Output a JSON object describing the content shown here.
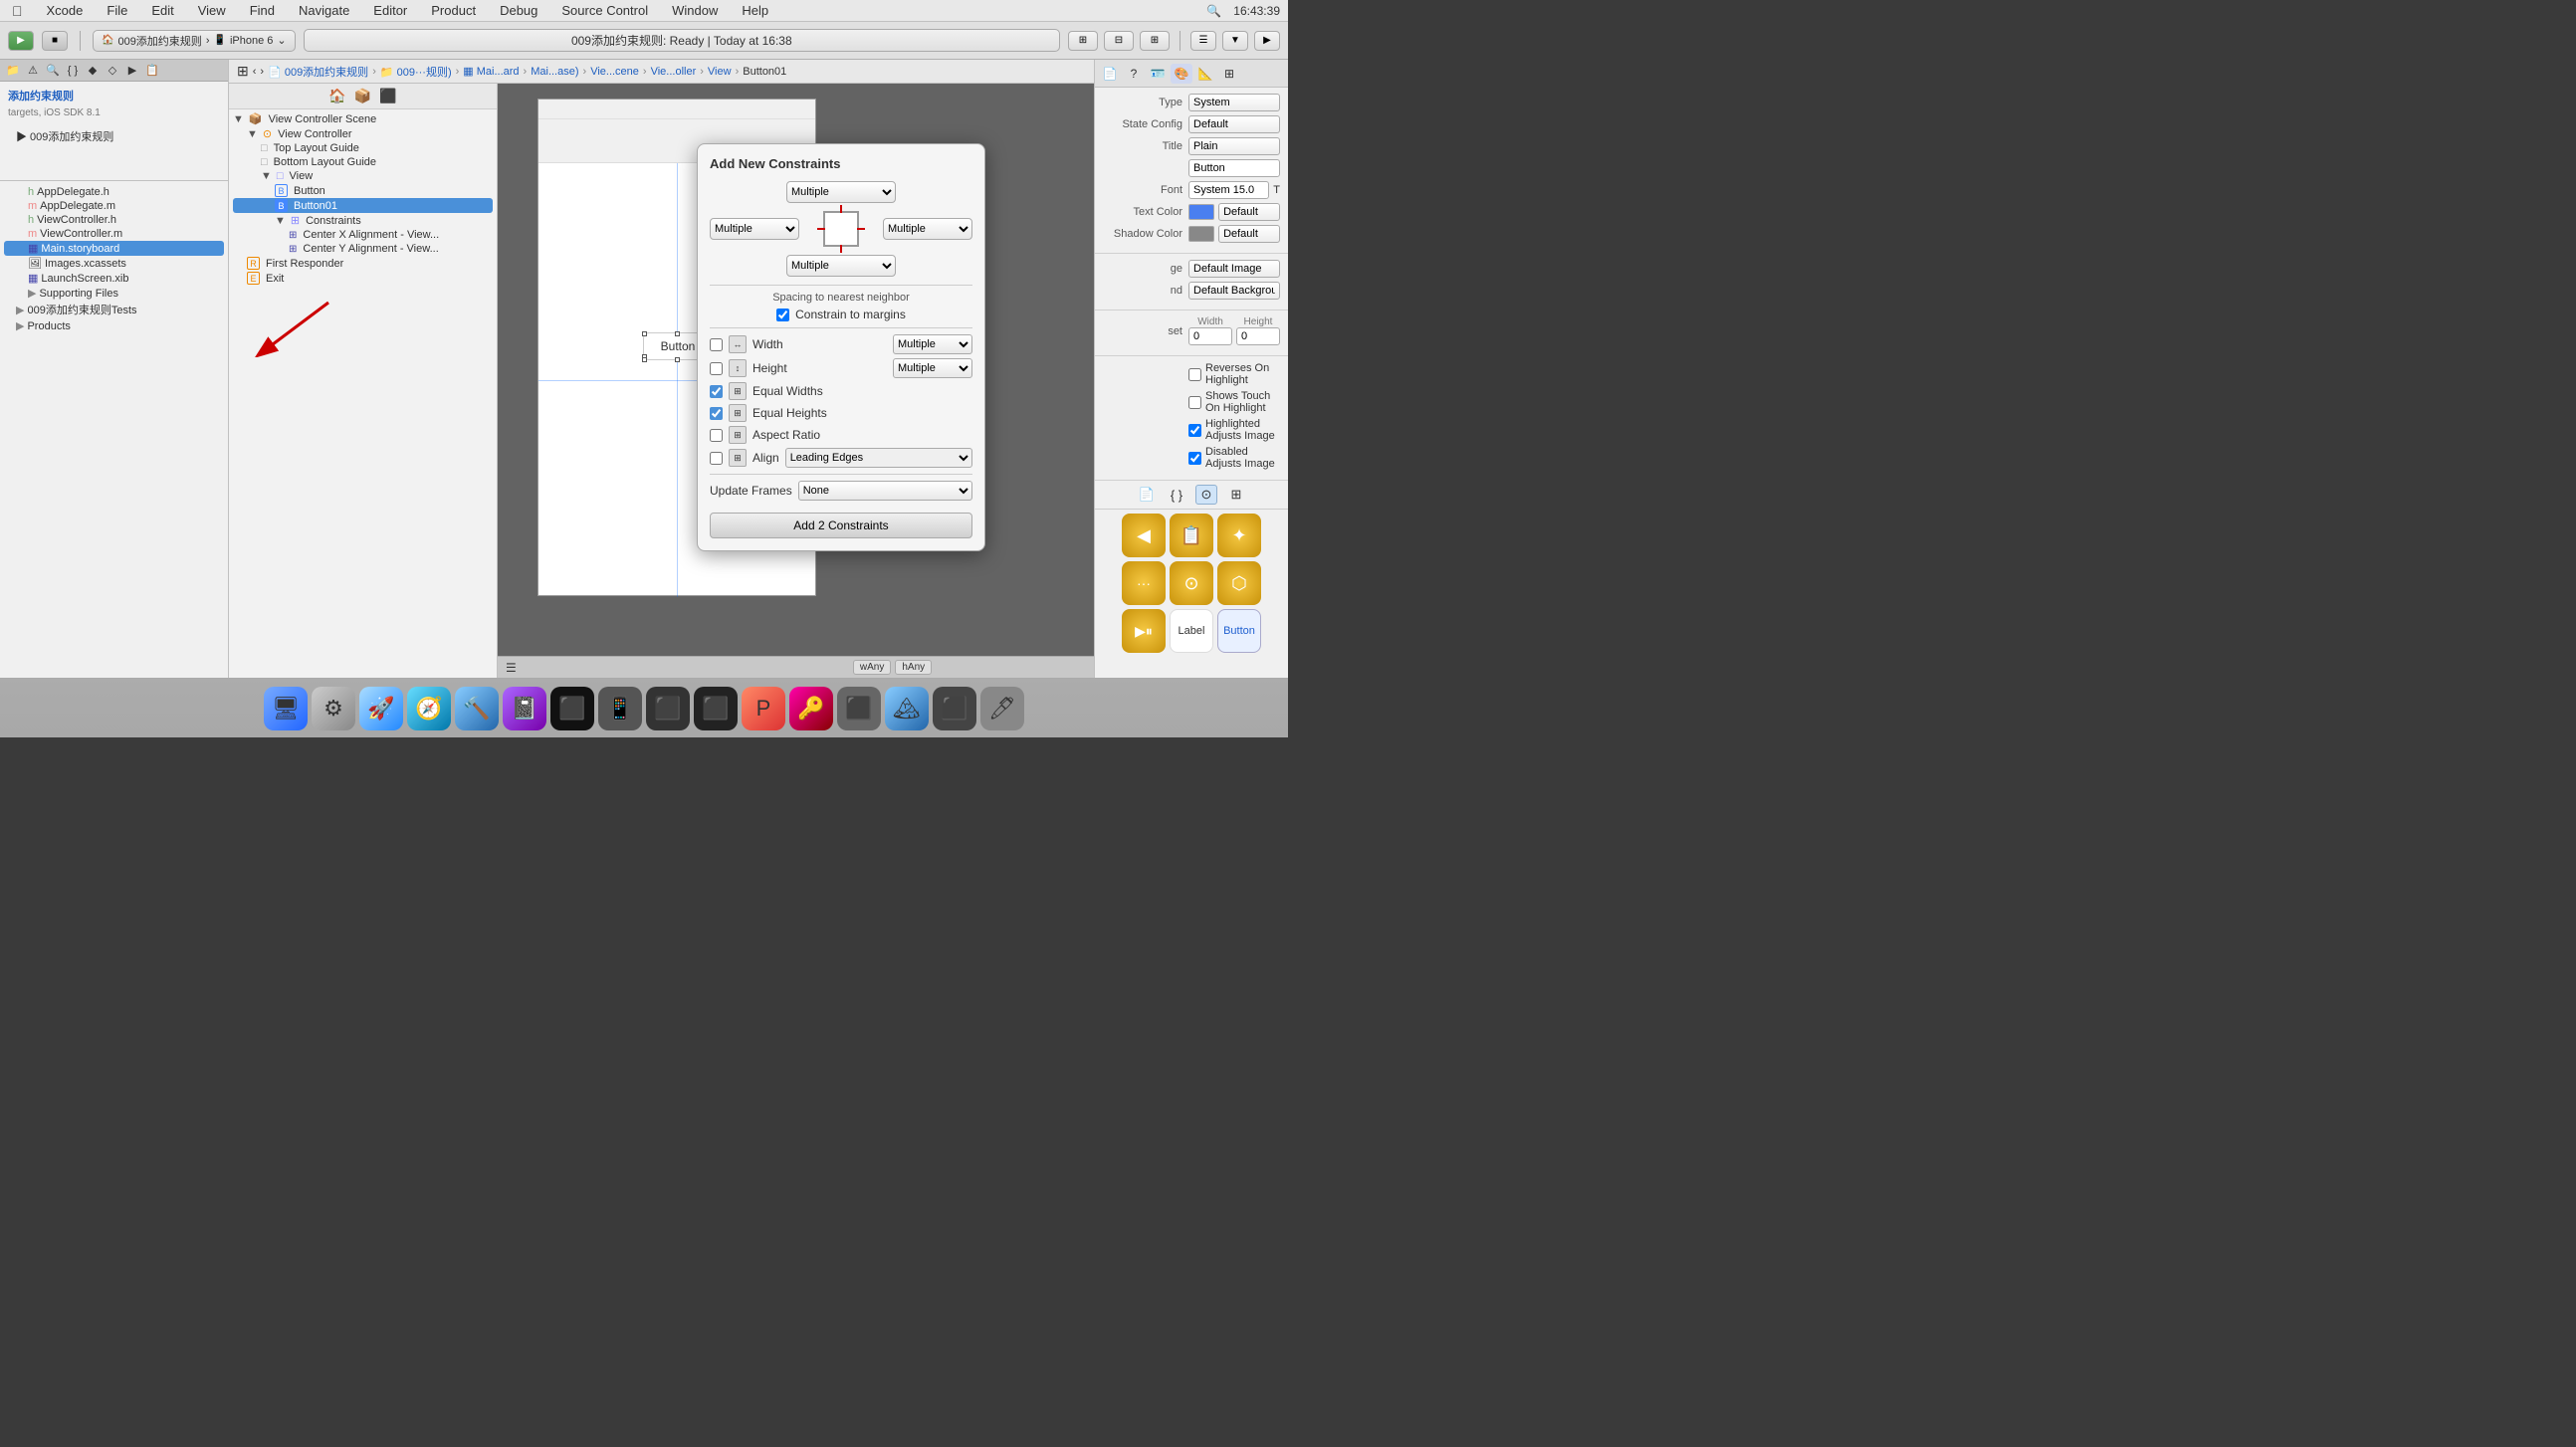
{
  "menubar": {
    "apple": "",
    "items": [
      "Xcode",
      "File",
      "Edit",
      "View",
      "Find",
      "Navigate",
      "Editor",
      "Product",
      "Debug",
      "Source Control",
      "Window",
      "Help"
    ],
    "right": {
      "plus_icon": "+",
      "time": "16:43:39"
    }
  },
  "toolbar": {
    "play_label": "▶",
    "stop_label": "■",
    "scheme": "009添加约束规则",
    "device": "iPhone 6",
    "status": "009添加约束规则: Ready  |  Today at 16:38"
  },
  "tabbar": {
    "title": "Main.storyboard"
  },
  "breadcrumb": {
    "items": [
      "009添加约束规则",
      "009···规则)",
      "Mai...ard",
      "Mai...ase)",
      "Vie...cene",
      "Vie...oller",
      "View",
      "Button01"
    ]
  },
  "navigator": {
    "title": "添加约束规则",
    "subtitle": "targets, iOS SDK 8.1",
    "items": [
      "009添加约束规则",
      "AppDelegate.h",
      "AppDelegate.m",
      "ViewController.h",
      "ViewController.m",
      "Main.storyboard",
      "Images.xcassets",
      "LaunchScreen.xib",
      "Supporting Files",
      "009添加约束规则Tests",
      "Products"
    ],
    "selected": "Main.storyboard"
  },
  "scene_tree": {
    "items": [
      {
        "label": "View Controller Scene",
        "level": 0,
        "expanded": true,
        "icon": "▼"
      },
      {
        "label": "View Controller",
        "level": 1,
        "expanded": true,
        "icon": "▼"
      },
      {
        "label": "Top Layout Guide",
        "level": 2,
        "icon": "□"
      },
      {
        "label": "Bottom Layout Guide",
        "level": 2,
        "icon": "□"
      },
      {
        "label": "View",
        "level": 2,
        "expanded": true,
        "icon": "▼"
      },
      {
        "label": "Button",
        "level": 3,
        "icon": "B"
      },
      {
        "label": "Button01",
        "level": 3,
        "icon": "B",
        "selected": true
      },
      {
        "label": "Constraints",
        "level": 3,
        "expanded": true,
        "icon": "▼"
      },
      {
        "label": "Center X Alignment - View...",
        "level": 4,
        "icon": "="
      },
      {
        "label": "Center Y Alignment - View...",
        "level": 4,
        "icon": "="
      },
      {
        "label": "First Responder",
        "level": 1,
        "icon": "R"
      },
      {
        "label": "Exit",
        "level": 1,
        "icon": "E"
      }
    ]
  },
  "inspector": {
    "type_label": "Type",
    "type_value": "System",
    "state_label": "State Config",
    "state_value": "Default",
    "title_label": "Title",
    "title_value": "Plain",
    "button_text": "Button",
    "font_label": "Font",
    "font_value": "System 15.0",
    "text_color_label": "Text Color",
    "text_color_value": "Default",
    "shadow_color_label": "Shadow Color",
    "shadow_color_value": "Default",
    "image_label": "Default Image",
    "bg_image_label": "Default Background Image",
    "width_label": "Width",
    "height_label": "Height",
    "width_value": "0",
    "height_value": "0",
    "reverses_label": "Reverses On Highlight",
    "shows_touch_label": "Shows Touch On Highlight",
    "highlighted_label": "Highlighted Adjusts Image",
    "disabled_label": "Disabled Adjusts Image",
    "lib_icons": [
      {
        "name": "back-icon",
        "symbol": "◀",
        "color": "gold"
      },
      {
        "name": "copy-icon",
        "symbol": "📋",
        "color": "gold"
      },
      {
        "name": "star-icon",
        "symbol": "✦",
        "color": "gold"
      },
      {
        "name": "dots-icon",
        "symbol": "···",
        "color": "gold"
      },
      {
        "name": "camera-icon",
        "symbol": "⊙",
        "color": "gold"
      },
      {
        "name": "cube-icon",
        "symbol": "⬡",
        "color": "gold"
      },
      {
        "name": "play-label-icon",
        "symbol": "▶",
        "color": "gold"
      },
      {
        "name": "label-icon",
        "symbol": "Label",
        "color": "white"
      },
      {
        "name": "button-icon",
        "symbol": "Button",
        "color": "blue"
      }
    ]
  },
  "constraints_popup": {
    "title": "Add New Constraints",
    "top_select": "Multiple",
    "left_select": "Multiple",
    "right_select": "Multiple",
    "bottom_select": "Multiple",
    "spacing_label": "Spacing to nearest neighbor",
    "constrain_margins": "Constrain to margins",
    "width_label": "Width",
    "height_label": "Height",
    "equal_widths_label": "Equal Widths",
    "equal_heights_label": "Equal Heights",
    "aspect_ratio_label": "Aspect Ratio",
    "align_label": "Align",
    "align_value": "Leading Edges",
    "update_frames_label": "Update Frames",
    "update_frames_value": "None",
    "add_btn_label": "Add 2 Constraints",
    "width_checked": false,
    "height_checked": false,
    "equal_widths_checked": true,
    "equal_heights_checked": true,
    "aspect_ratio_checked": false,
    "align_checked": false
  },
  "statusbar": {
    "left": "▼",
    "right_icons": [
      "wAny",
      "hAny"
    ],
    "bottom_icons": [
      "⊞",
      "⊞",
      "⊞",
      "⊟"
    ]
  },
  "dock": {
    "icons": [
      "🍎",
      "⚙",
      "🚀",
      "🧭",
      "🤖",
      "📓",
      "⬛",
      "⬛",
      "⬛",
      "⬛",
      "⬛",
      "⬛",
      "⬛",
      "🔑",
      "⬛",
      "🏔",
      "⬛",
      "🖊"
    ]
  }
}
